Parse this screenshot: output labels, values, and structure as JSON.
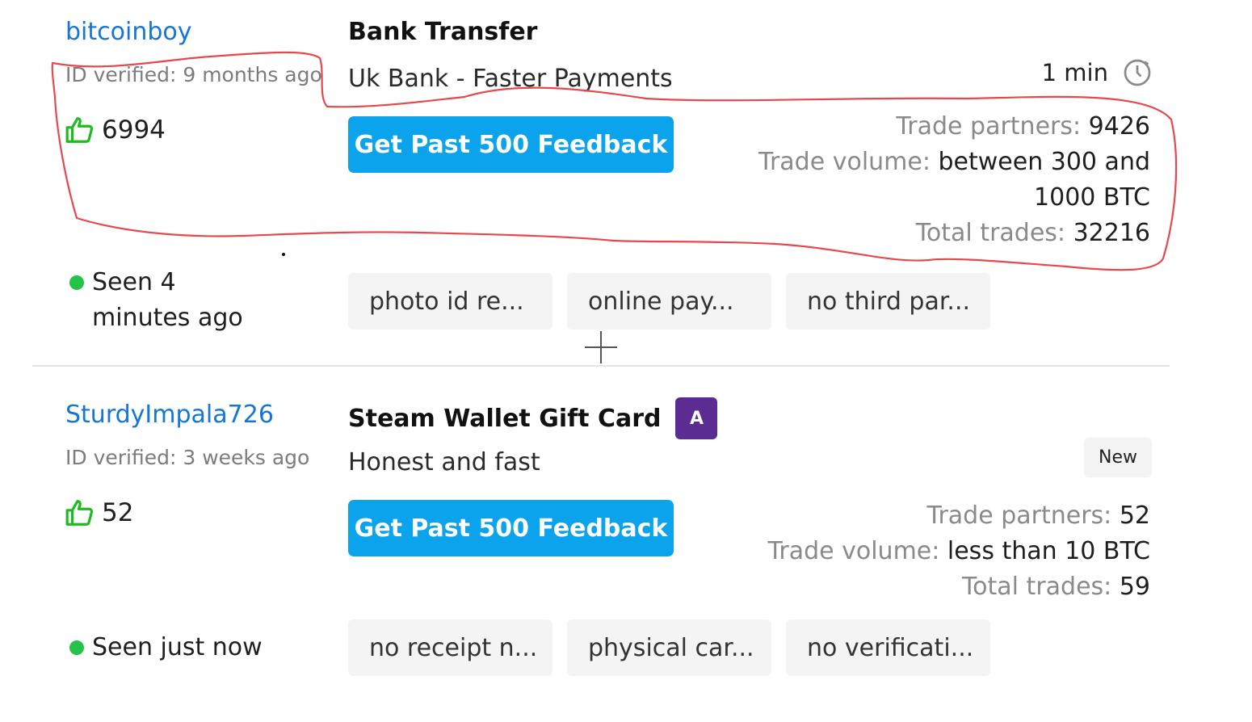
{
  "offers": [
    {
      "username": "bitcoinboy",
      "id_verified": "ID verified: 9 months ago",
      "feedback_count": "6994",
      "seen": "Seen 4 minutes ago",
      "payment_method": "Bank Transfer",
      "subtitle": "Uk Bank - Faster Payments",
      "button": "Get Past 500 Feedback",
      "time": "1 min",
      "stats": {
        "partners_label": "Trade partners: ",
        "partners_value": "9426",
        "volume_label": "Trade volume: ",
        "volume_value_line1": "between 300 and",
        "volume_value_line2": "1000 BTC",
        "total_label": "Total trades: ",
        "total_value": "32216"
      },
      "tags": [
        "photo id re...",
        "online pay...",
        "no third par..."
      ]
    },
    {
      "username": "SturdyImpala726",
      "id_verified": "ID verified: 3 weeks ago",
      "feedback_count": "52",
      "seen": "Seen just now",
      "payment_method": "Steam Wallet Gift Card",
      "method_badge": "A",
      "subtitle": "Honest and fast",
      "button": "Get Past 500 Feedback",
      "new_badge": "New",
      "stats": {
        "partners_label": "Trade partners: ",
        "partners_value": "52",
        "volume_label": "Trade volume: ",
        "volume_value": "less than 10 BTC",
        "total_label": "Total trades: ",
        "total_value": "59"
      },
      "tags": [
        "no receipt n...",
        "physical car...",
        "no verificati..."
      ]
    }
  ],
  "colors": {
    "link": "#1476d6",
    "button": "#0aa3ec",
    "online_dot": "#23c34a",
    "thumb": "#1dbb1d",
    "badge_a": "#5b2c91",
    "annotation": "#e5484d"
  },
  "icons": [
    "thumbs-up-icon",
    "clock-icon",
    "plus-icon",
    "online-dot"
  ]
}
